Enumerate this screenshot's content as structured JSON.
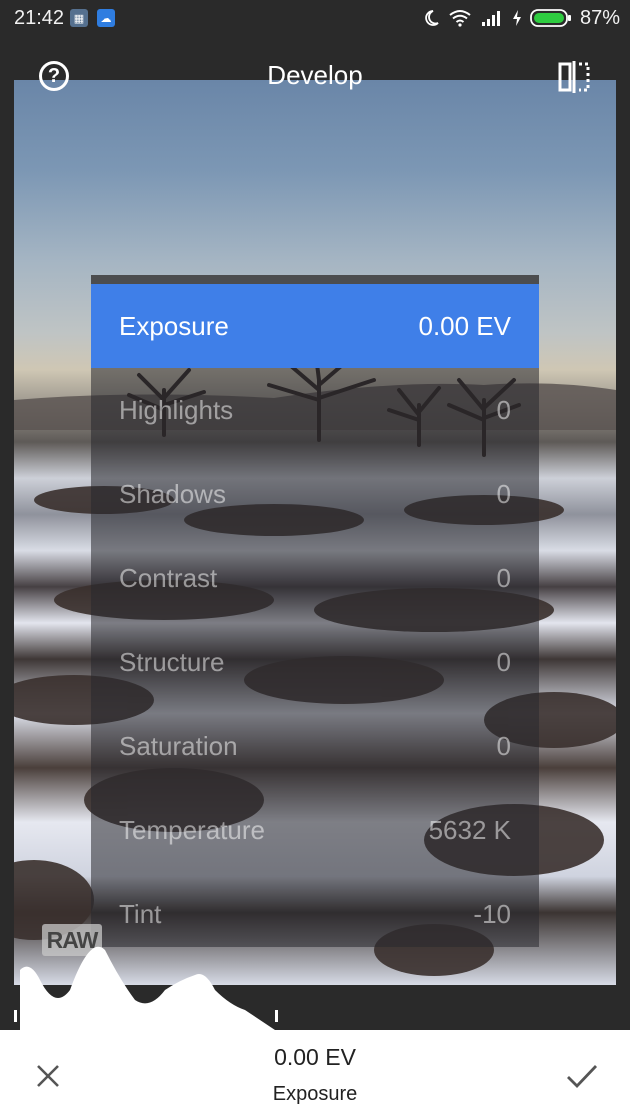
{
  "status_bar": {
    "time": "21:42",
    "battery": "87%"
  },
  "header": {
    "title": "Develop"
  },
  "menu": {
    "items": [
      {
        "label": "Exposure",
        "value": "0.00 EV"
      },
      {
        "label": "Highlights",
        "value": "0"
      },
      {
        "label": "Shadows",
        "value": "0"
      },
      {
        "label": "Contrast",
        "value": "0"
      },
      {
        "label": "Structure",
        "value": "0"
      },
      {
        "label": "Saturation",
        "value": "0"
      },
      {
        "label": "Temperature",
        "value": "5632 K"
      },
      {
        "label": "Tint",
        "value": "-10"
      }
    ],
    "selected_index": 0
  },
  "badge": {
    "raw": "RAW"
  },
  "bottom_bar": {
    "value": "0.00 EV",
    "label": "Exposure"
  },
  "colors": {
    "accent": "#3f7fe8",
    "background": "#2a2a2a"
  }
}
